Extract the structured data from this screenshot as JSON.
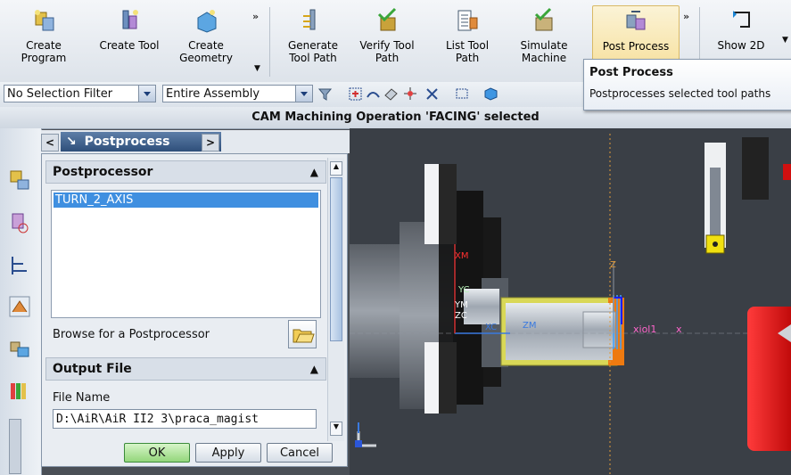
{
  "ribbon": {
    "buttons": [
      {
        "line1": "Create",
        "line2": "Program",
        "icon": "create-program-icon"
      },
      {
        "line1": "Create Tool",
        "line2": "",
        "icon": "create-tool-icon"
      },
      {
        "line1": "Create",
        "line2": "Geometry",
        "icon": "create-geometry-icon"
      },
      {
        "line1": "Generate",
        "line2": "Tool Path",
        "icon": "generate-tool-path-icon"
      },
      {
        "line1": "Verify Tool",
        "line2": "Path",
        "icon": "verify-tool-path-icon"
      },
      {
        "line1": "List Tool",
        "line2": "Path",
        "icon": "list-tool-path-icon"
      },
      {
        "line1": "Simulate",
        "line2": "Machine",
        "icon": "simulate-machine-icon"
      },
      {
        "line1": "Post Process",
        "line2": "",
        "icon": "post-process-icon"
      },
      {
        "line1": "Show 2D",
        "line2": "",
        "icon": "show-2d-icon"
      }
    ],
    "more_glyph": "»"
  },
  "selection_bar": {
    "filter": "No Selection Filter",
    "scope": "Entire Assembly"
  },
  "status": {
    "message": "CAM Machining Operation 'FACING' selected"
  },
  "tooltip": {
    "title": "Post Process",
    "description": "Postprocesses selected tool paths"
  },
  "dialog": {
    "tab_title": "Postprocess",
    "postprocessor": {
      "header": "Postprocessor",
      "items": [
        "TURN_2_AXIS"
      ],
      "browse_label": "Browse for a Postprocessor"
    },
    "output_file": {
      "header": "Output File",
      "file_name_label": "File Name",
      "file_name_value": "D:\\AiR\\AiR II2 3\\praca_magist"
    },
    "buttons": {
      "ok": "OK",
      "apply": "Apply",
      "cancel": "Cancel"
    }
  },
  "viewport": {
    "labels": {
      "xm": "XM",
      "yc": "YC",
      "ym": "YM",
      "zc": "ZC",
      "xc": "XC",
      "zm": "ZM",
      "z": "Z",
      "x": "x",
      "xi": "xiol1"
    }
  },
  "colors": {
    "accent_hover": "#f6df9a",
    "selection_blue": "#3f8fe0",
    "viewport_bg": "#3a3f46",
    "part_yellow": "#d9d857",
    "part_orange": "#ee7a10",
    "tool_red": "#e01010"
  }
}
